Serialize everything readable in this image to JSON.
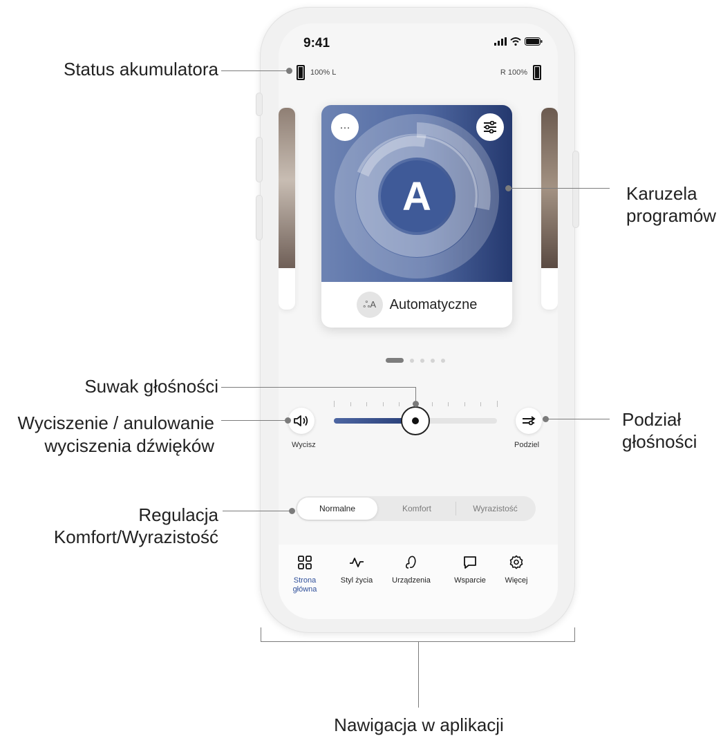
{
  "annotations": {
    "battery_status": "Status akumulatora",
    "program_carousel_line1": "Karuzela",
    "program_carousel_line2": "programów",
    "volume_slider": "Suwak głośności",
    "mute_line1": "Wyciszenie / anulowanie",
    "mute_line2": "wyciszenia dźwięków",
    "split_line1": "Podział",
    "split_line2": "głośności",
    "comfort_line1": "Regulacja",
    "comfort_line2": "Komfort/Wyrazistość",
    "navigation": "Nawigacja w aplikacji"
  },
  "status_bar": {
    "time": "9:41"
  },
  "battery": {
    "left": "100% L",
    "right": "R 100%"
  },
  "carousel": {
    "more_label": "···",
    "program_letter": "A",
    "program_name": "Automatyczne",
    "program_icon_text": "ஃA",
    "page_count": 5,
    "active_page": 1
  },
  "volume": {
    "mute_label": "Wycisz",
    "split_label": "Podziel",
    "level": 0.5
  },
  "sound_mode": {
    "options": [
      "Normalne",
      "Komfort",
      "Wyrazistość"
    ],
    "selected": "Normalne"
  },
  "nav": {
    "items": [
      {
        "label": "Strona główna",
        "icon": "grid-icon",
        "active": true
      },
      {
        "label": "Styl życia",
        "icon": "activity-icon",
        "active": false
      },
      {
        "label": "Urządzenia",
        "icon": "hearing-aid-icon",
        "active": false
      },
      {
        "label": "Wsparcie",
        "icon": "chat-bubble-icon",
        "active": false
      },
      {
        "label": "Więcej",
        "icon": "gear-icon",
        "active": false
      }
    ]
  },
  "colors": {
    "accent": "#2f4f9a",
    "card_gradient_start": "#6d83b3",
    "card_gradient_end": "#24386e"
  }
}
